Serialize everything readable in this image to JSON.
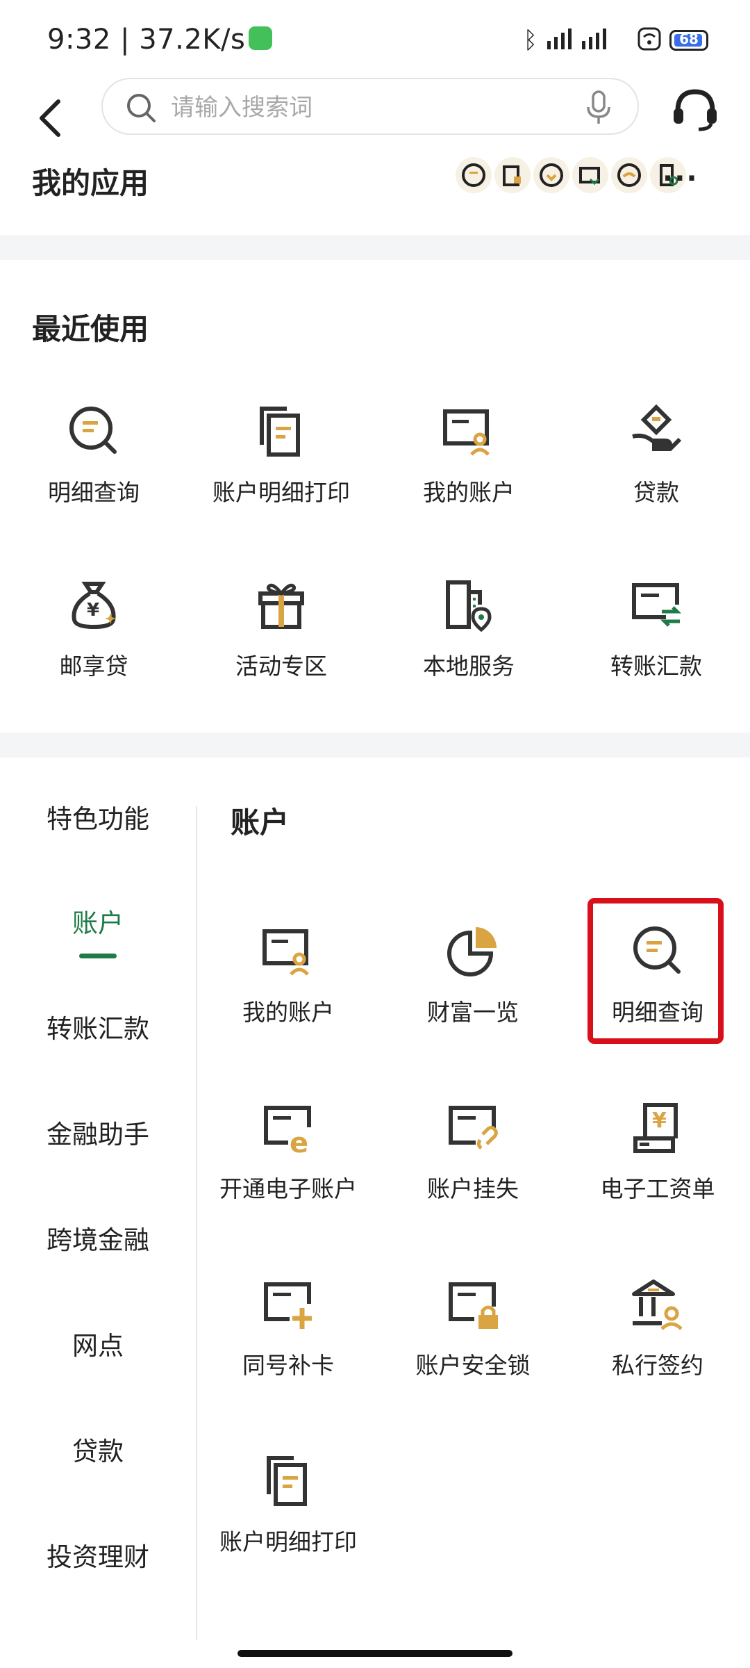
{
  "status": {
    "time": "9:32 | 37.2K/s",
    "battery": "68"
  },
  "search": {
    "placeholder": "请输入搜索词"
  },
  "my_apps": {
    "title": "我的应用",
    "more": "···"
  },
  "recent": {
    "title": "最近使用",
    "items": [
      {
        "label": "明细查询",
        "icon": "detail-query-icon"
      },
      {
        "label": "账户明细打印",
        "icon": "account-print-icon"
      },
      {
        "label": "我的账户",
        "icon": "my-account-icon"
      },
      {
        "label": "贷款",
        "icon": "loan-icon"
      },
      {
        "label": "邮享贷",
        "icon": "money-bag-icon"
      },
      {
        "label": "活动专区",
        "icon": "gift-icon"
      },
      {
        "label": "本地服务",
        "icon": "local-service-icon"
      },
      {
        "label": "转账汇款",
        "icon": "transfer-icon"
      }
    ]
  },
  "sidebar": {
    "items": [
      "特色功能",
      "账户",
      "转账汇款",
      "金融助手",
      "跨境金融",
      "网点",
      "贷款",
      "投资理财"
    ],
    "active_index": 1
  },
  "account_section": {
    "title": "账户",
    "items": [
      {
        "label": "我的账户",
        "icon": "my-account-icon"
      },
      {
        "label": "财富一览",
        "icon": "pie-chart-icon"
      },
      {
        "label": "明细查询",
        "icon": "detail-query-icon"
      },
      {
        "label": "开通电子账户",
        "icon": "e-account-icon"
      },
      {
        "label": "账户挂失",
        "icon": "report-loss-icon"
      },
      {
        "label": "电子工资单",
        "icon": "payslip-icon"
      },
      {
        "label": "同号补卡",
        "icon": "card-reissue-icon"
      },
      {
        "label": "账户安全锁",
        "icon": "security-lock-icon"
      },
      {
        "label": "私行签约",
        "icon": "private-bank-icon"
      },
      {
        "label": "账户明细打印",
        "icon": "account-print-icon"
      }
    ]
  },
  "colors": {
    "accent": "#1e7a46",
    "gold": "#d9a441",
    "dark": "#333333",
    "highlight": "#d8101b"
  }
}
